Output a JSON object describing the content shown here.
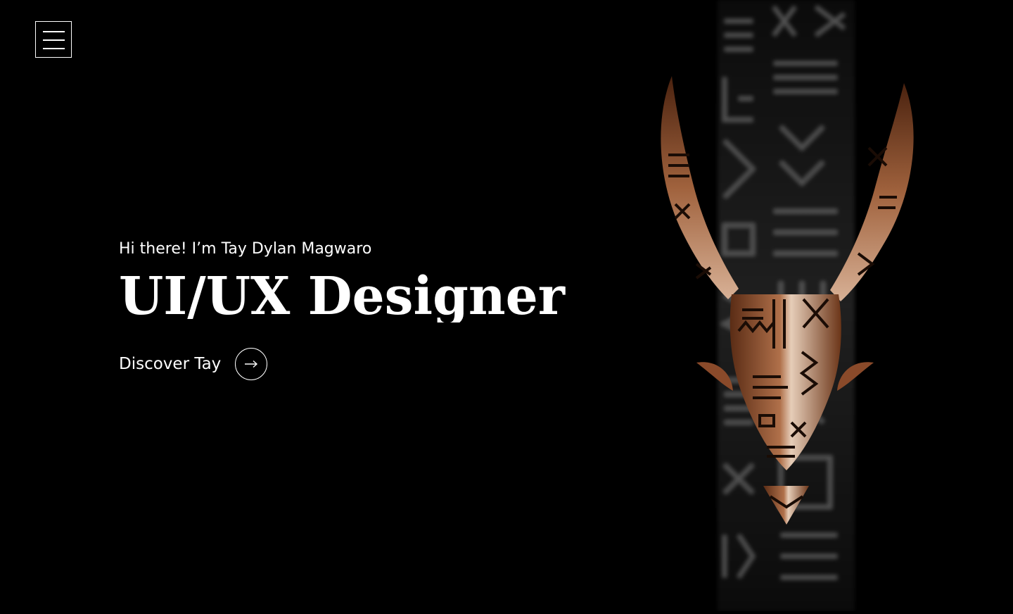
{
  "nav": {
    "menu_icon": "hamburger-menu-icon"
  },
  "hero": {
    "greeting": "Hi there! I’m Tay Dylan Magwaro",
    "headline": "UI/UX Designer",
    "cta_label": "Discover Tay",
    "cta_icon": "arrow-right-icon"
  },
  "artwork": {
    "subject": "patterned-antelope-skull-artwork",
    "background_pattern": "tribal-glyph-column",
    "accent_colors": [
      "#8a4a2a",
      "#c48a63",
      "#e9d2bf",
      "#3a1c0f"
    ]
  },
  "colors": {
    "background": "#000000",
    "text": "#ffffff"
  }
}
